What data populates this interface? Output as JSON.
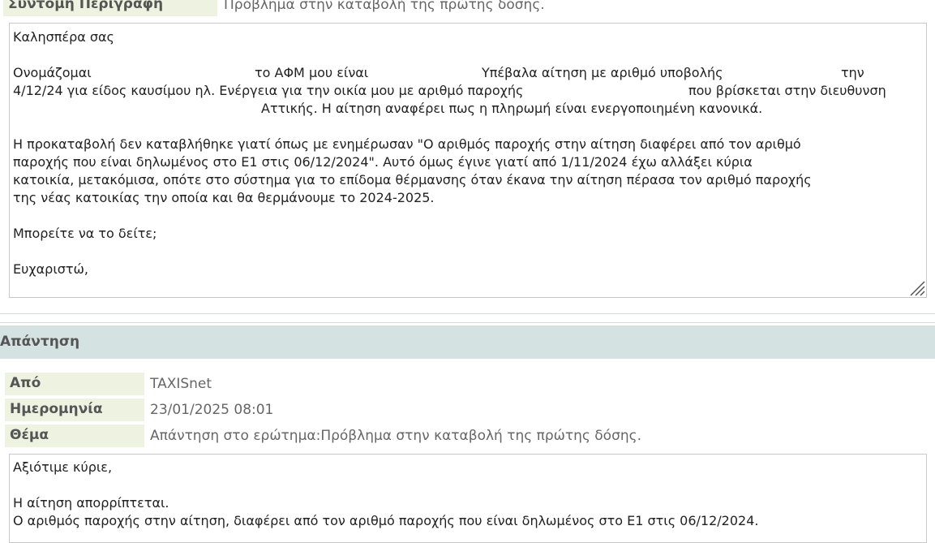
{
  "question": {
    "short_desc_label": "Σύντομη Περιγραφή",
    "short_desc_value": "Πρόβλημα στην καταβολή της πρώτης δόσης.",
    "body_lines": {
      "l1": "Καλησπέρα σας",
      "l2a": "Ονομάζομαι",
      "l2b": "το ΑΦΜ μου είναι",
      "l2c": "Υπέβαλα αίτηση με αριθμό υποβολής",
      "l2d": "την",
      "l3a": "4/12/24 για είδος καυσίμου ηλ. Ενέργεια για την οικία μου με αριθμό παροχής",
      "l3b": "που βρίσκεται στην διευθυνση",
      "l4": "Αττικής. Η αίτηση αναφέρει πως η πληρωμή είναι ενεργοποιημένη κανονικά.",
      "l5": "Η προκαταβολή δεν καταβλήθηκε γιατί όπως με ενημέρωσαν \"Ο αριθμός παροχής στην αίτηση διαφέρει από τον αριθμό",
      "l6": "παροχής που είναι δηλωμένος στο Ε1 στις 06/12/2024\". Αυτό όμως έγινε γιατί από 1/11/2024 έχω αλλάξει κύρια",
      "l7": "κατοικία, μετακόμισα, οπότε στο σύστημα για το επίδομα θέρμανσης όταν έκανα την αίτηση πέρασα τον αριθμό παροχής",
      "l8": "της νέας κατοικίας την οποία και θα θερμάνουμε το 2024-2025.",
      "l9": "Μπορείτε να το δείτε;",
      "l10": "Ευχαριστώ,"
    }
  },
  "answer": {
    "section_title": "Απάντηση",
    "from_label": "Από",
    "from_value": "TAXISnet",
    "date_label": "Ημερομηνία",
    "date_value": "23/01/2025 08:01",
    "subject_label": "Θέμα",
    "subject_value": "Απάντηση στο ερώτημα:Πρόβλημα στην καταβολή της πρώτης δόσης.",
    "body_lines": {
      "l1": "Αξιότιμε κύριε,",
      "l2": "Η αίτηση απορρίπτεται.",
      "l3": "Ο αριθμός παροχής στην αίτηση, διαφέρει από τον αριθμό παροχής που είναι δηλωμένος στο Ε1 στις 06/12/2024."
    }
  },
  "colors": {
    "label_bg": "#eef2e0",
    "section_header_bg": "#d4e3e1",
    "border": "#c9c9c9"
  }
}
